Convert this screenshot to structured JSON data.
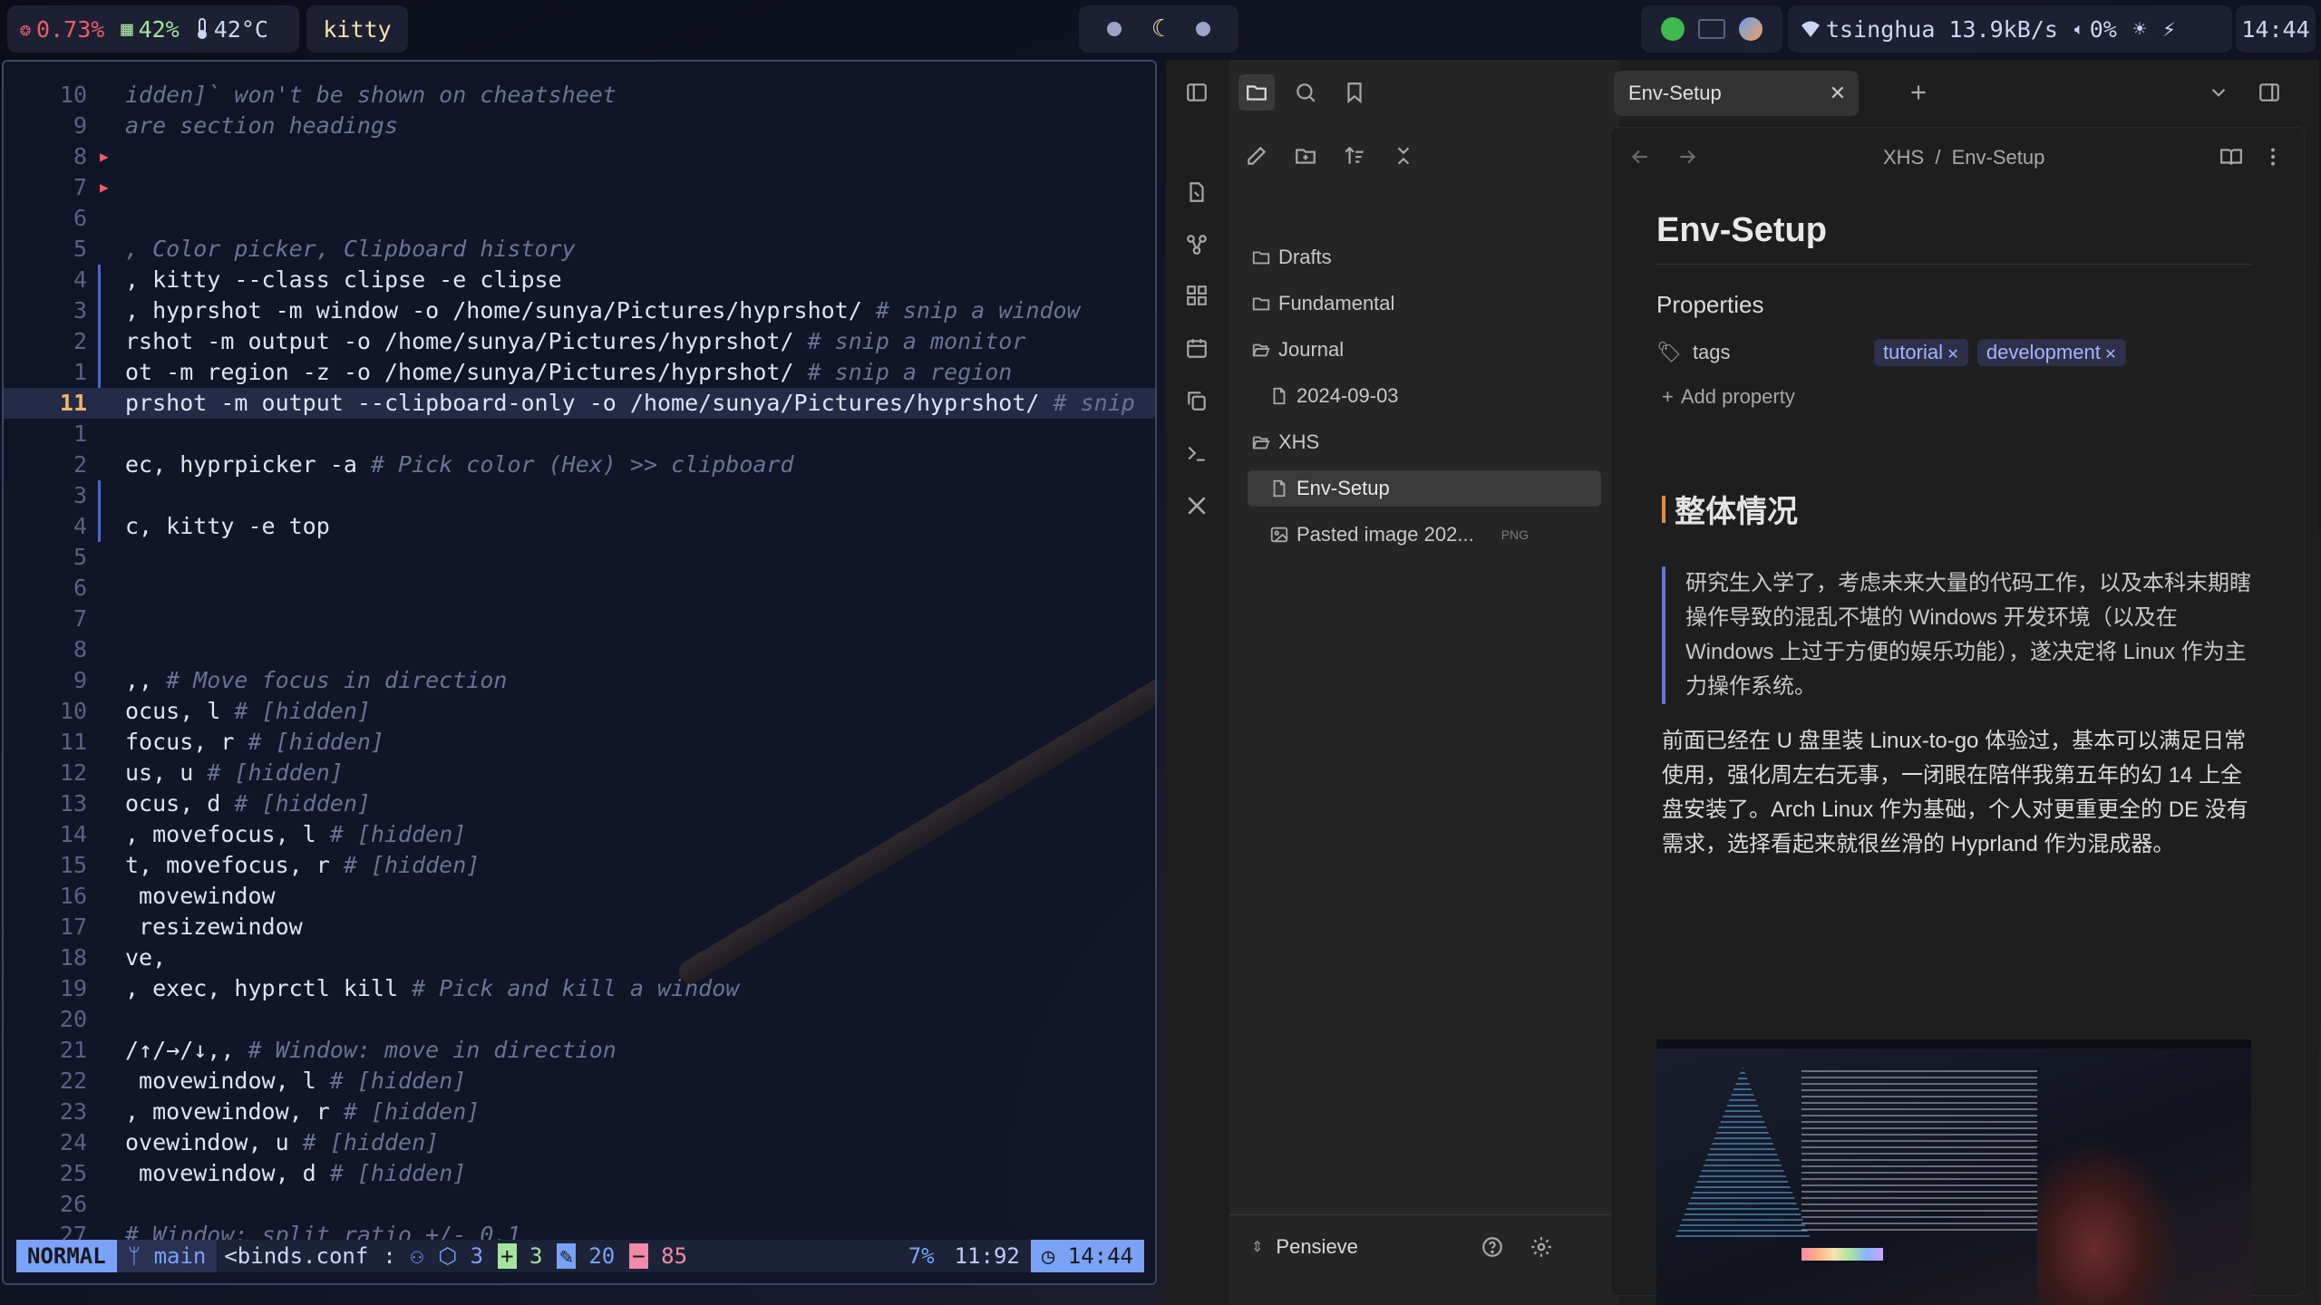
{
  "topbar": {
    "cpu": "0.73%",
    "mem": "42%",
    "temp": "42°C",
    "active_window": "kitty",
    "network": "tsinghua 13.9kB/s",
    "volume": "0%",
    "time": "14:44"
  },
  "editor": {
    "lines": [
      {
        "num": "10",
        "text": "idden]` won't be shown on cheatsheet",
        "comment": true
      },
      {
        "num": "9",
        "text": "are section headings",
        "comment": true
      },
      {
        "num": "8",
        "text": "",
        "sign": true
      },
      {
        "num": "7",
        "text": "",
        "sign": true
      },
      {
        "num": "6",
        "text": ""
      },
      {
        "num": "5",
        "text": ", Color picker, Clipboard history",
        "comment": true
      },
      {
        "num": "4",
        "code": ", kitty --class clipse -e clipse",
        "bar": true
      },
      {
        "num": "3",
        "code": ", hyprshot -m window -o /home/sunya/Pictures/hyprshot/ ",
        "cmt": "# snip a window",
        "bar": true
      },
      {
        "num": "2",
        "code": "rshot -m output -o /home/sunya/Pictures/hyprshot/ ",
        "cmt": "# snip a monitor",
        "bar": true
      },
      {
        "num": "1",
        "code": "ot -m region -z -o /home/sunya/Pictures/hyprshot/ ",
        "cmt": "# snip a region",
        "bar": true
      },
      {
        "num": "11",
        "code": "prshot -m output --clipboard-only -o /home/sunya/Pictures/hyprshot/ ",
        "cmt": "# snip",
        "current": true
      },
      {
        "num": "1",
        "text": ""
      },
      {
        "num": "2",
        "code": "ec, hyprpicker -a ",
        "cmt": "# Pick color (Hex) >> clipboard"
      },
      {
        "num": "3",
        "text": "",
        "bar": true
      },
      {
        "num": "4",
        "code": "c, kitty -e top",
        "bar": true
      },
      {
        "num": "5",
        "text": ""
      },
      {
        "num": "6",
        "text": ""
      },
      {
        "num": "7",
        "text": ""
      },
      {
        "num": "8",
        "text": ""
      },
      {
        "num": "9",
        "code": ",, ",
        "cmt": "# Move focus in direction"
      },
      {
        "num": "10",
        "code": "ocus, l ",
        "cmt": "# [hidden]"
      },
      {
        "num": "11",
        "code": "focus, r ",
        "cmt": "# [hidden]"
      },
      {
        "num": "12",
        "code": "us, u ",
        "cmt": "# [hidden]"
      },
      {
        "num": "13",
        "code": "ocus, d ",
        "cmt": "# [hidden]"
      },
      {
        "num": "14",
        "code": ", movefocus, l ",
        "cmt": "# [hidden]"
      },
      {
        "num": "15",
        "code": "t, movefocus, r ",
        "cmt": "# [hidden]"
      },
      {
        "num": "16",
        "code": " movewindow"
      },
      {
        "num": "17",
        "code": " resizewindow"
      },
      {
        "num": "18",
        "code": "ve,"
      },
      {
        "num": "19",
        "code": ", exec, hyprctl kill ",
        "cmt": "# Pick and kill a window"
      },
      {
        "num": "20",
        "text": ""
      },
      {
        "num": "21",
        "code": "/↑/→/↓,, ",
        "cmt": "# Window: move in direction"
      },
      {
        "num": "22",
        "code": " movewindow, l ",
        "cmt": "# [hidden]"
      },
      {
        "num": "23",
        "code": ", movewindow, r ",
        "cmt": "# [hidden]"
      },
      {
        "num": "24",
        "code": "ovewindow, u ",
        "cmt": "# [hidden]"
      },
      {
        "num": "25",
        "code": " movewindow, d ",
        "cmt": "# [hidden]"
      },
      {
        "num": "26",
        "text": ""
      },
      {
        "num": "27",
        "text": "# Window: split ratio +/- 0.1",
        "comment": true
      }
    ],
    "status": {
      "mode": "NORMAL",
      "branch": "main",
      "file": "<binds.conf",
      "sep": ":",
      "lsp_count": "3",
      "added": "3",
      "changed": "20",
      "removed": "85",
      "percent": "7%",
      "position": "11:92",
      "clock": "14:44"
    }
  },
  "obsidian": {
    "tab_title": "Env-Setup",
    "breadcrumb": {
      "folder": "XHS",
      "sep": "/",
      "file": "Env-Setup"
    },
    "tree": [
      {
        "label": "Drafts",
        "type": "folder"
      },
      {
        "label": "Fundamental",
        "type": "folder"
      },
      {
        "label": "Journal",
        "type": "folder-open"
      },
      {
        "label": "2024-09-03",
        "type": "file"
      },
      {
        "label": "XHS",
        "type": "folder-open"
      },
      {
        "label": "Env-Setup",
        "type": "file"
      },
      {
        "label": "Pasted image 202...",
        "type": "image",
        "badge": "PNG"
      }
    ],
    "vault_name": "Pensieve",
    "note": {
      "title": "Env-Setup",
      "properties_heading": "Properties",
      "tags_label": "tags",
      "tags": [
        "tutorial",
        "development"
      ],
      "add_property": "Add property",
      "section_heading": "整体情况",
      "quote": "研究生入学了，考虑未来大量的代码工作，以及本科末期瞎操作导致的混乱不堪的 Windows 开发环境（以及在 Windows 上过于方便的娱乐功能），遂决定将 Linux 作为主力操作系统。",
      "paragraph": "前面已经在 U 盘里装 Linux-to-go 体验过，基本可以满足日常使用，强化周左右无事，一闭眼在陪伴我第五年的幻 14 上全盘安装了。Arch Linux 作为基础，个人对更重更全的 DE 没有需求，选择看起来就很丝滑的 Hyprland 作为混成器。"
    }
  },
  "colors": {
    "accent": "#7aa2f7",
    "obsidian_accent": "#a6b3ff",
    "heading_bar": "#e08a4a"
  }
}
